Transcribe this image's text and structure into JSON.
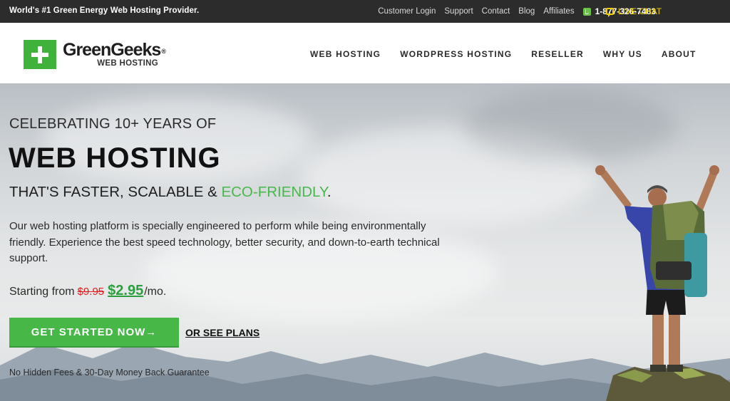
{
  "topbar": {
    "tagline": "World's #1 Green Energy Web Hosting Provider.",
    "links": [
      "Customer Login",
      "Support",
      "Contact",
      "Blog",
      "Affiliates"
    ],
    "phone": "1-877-326-7483",
    "live_chat": "LIVE CHAT",
    "phone_icon": "phone-icon",
    "chat_icon": "chat-icon"
  },
  "header": {
    "logo_name": "GreenGeeks",
    "logo_reg": "®",
    "logo_sub": "WEB HOSTING",
    "nav": [
      "WEB HOSTING",
      "WORDPRESS HOSTING",
      "RESELLER",
      "WHY US",
      "ABOUT"
    ]
  },
  "hero": {
    "celebrate": "CELEBRATING 10+ YEARS OF",
    "headline": "WEB HOSTING",
    "faster_prefix": "THAT'S FASTER, SCALABLE & ",
    "faster_green": "ECO-FRIENDLY",
    "faster_suffix": ".",
    "paragraph": "Our web hosting platform is specially engineered to perform while being environmentally friendly. Experience the best speed technology, better security, and down-to-earth technical support.",
    "price_prefix": "Starting from",
    "price_old": "$9.95",
    "price_new": "$2.95",
    "price_per": "/mo.",
    "cta_label": "GET STARTED NOW→",
    "see_plans": "OR SEE PLANS",
    "guarantee": "No Hidden Fees & 30-Day Money Back Guarantee"
  },
  "colors": {
    "brand_green": "#47b847",
    "topbar_bg": "#2c2c2c",
    "live_chat": "#f0d000",
    "price_old": "#e02020"
  }
}
